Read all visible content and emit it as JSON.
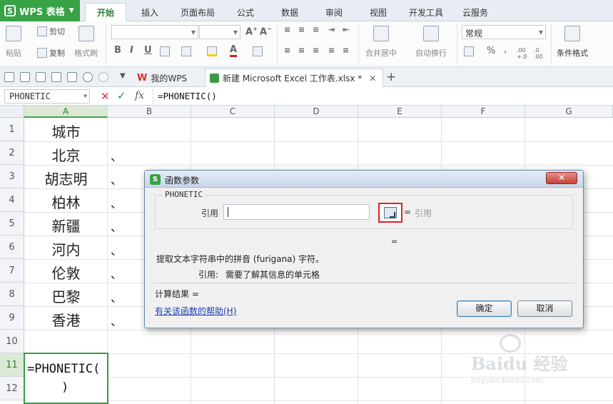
{
  "app": {
    "title": "WPS 表格",
    "logo_letter": "S"
  },
  "menu_tabs": [
    "开始",
    "插入",
    "页面布局",
    "公式",
    "数据",
    "审阅",
    "视图",
    "开发工具",
    "云服务"
  ],
  "ribbon": {
    "paste": "粘贴",
    "cut": "剪切",
    "copy": "复制",
    "format_painter": "格式刷",
    "merge_center": "合并居中",
    "auto_wrap": "自动换行",
    "number_format": "常规",
    "conditional_format": "条件格式",
    "percent": "%",
    "comma": "‚",
    "bold": "B",
    "italic": "I",
    "underline": "U"
  },
  "doc_tabs": [
    {
      "label": "我的WPS"
    },
    {
      "label": "新建 Microsoft Excel 工作表.xlsx *"
    }
  ],
  "formula_bar": {
    "name_box": "PHONETIC",
    "fx": "fx",
    "formula": "=PHONETIC()"
  },
  "columns": [
    "A",
    "B",
    "C",
    "D",
    "E",
    "F",
    "G"
  ],
  "rows": [
    "1",
    "2",
    "3",
    "4",
    "5",
    "6",
    "7",
    "8",
    "9",
    "10",
    "11",
    "12"
  ],
  "cells_a": [
    "城市",
    "北京",
    "胡志明",
    "柏林",
    "新疆",
    "河内",
    "伦敦",
    "巴黎",
    "香港"
  ],
  "cells_b_mark": "、",
  "active_cell_text": [
    "=PHONETIC(",
    ")"
  ],
  "dialog": {
    "title": "函数参数",
    "close": "✕",
    "function_name": "PHONETIC",
    "arg_label": "引用",
    "arg_eq": "=",
    "arg_hint": "引用",
    "result_eq": "=",
    "description": "提取文本字符串中的拼音 (furigana) 字符。",
    "arg_desc_label": "引用:",
    "arg_desc": "需要了解其信息的单元格",
    "calc_result": "计算结果 =",
    "help_link": "有关该函数的帮助(H)",
    "ok": "确定",
    "cancel": "取消"
  },
  "watermark": {
    "brand": "Baidu",
    "cn": "经验",
    "site": "jingyan.baidu.com"
  }
}
